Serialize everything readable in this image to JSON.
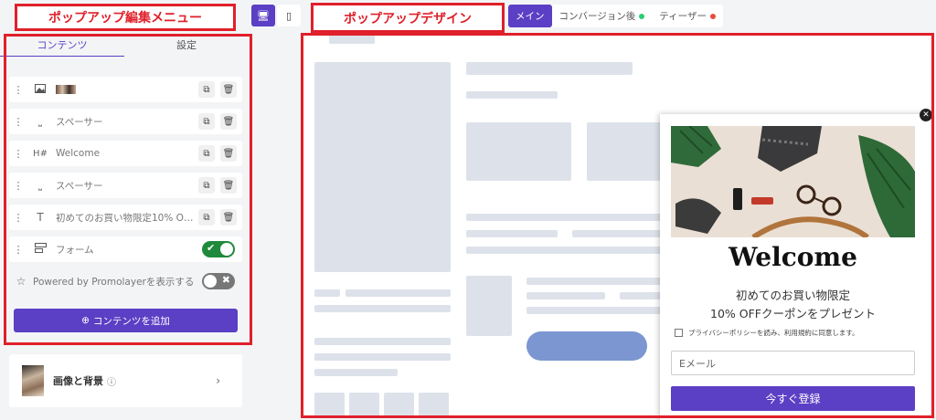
{
  "annotations": {
    "menu_label": "ポップアップ編集メニュー",
    "design_label": "ポップアップデザイン"
  },
  "editor": {
    "tabs": [
      "コンテンツ",
      "設定"
    ],
    "rows": [
      {
        "icon": "image-icon",
        "label": ""
      },
      {
        "icon": "spacer-icon",
        "label": "スペーサー"
      },
      {
        "icon": "heading-icon",
        "label": "Welcome"
      },
      {
        "icon": "spacer-icon",
        "label": "スペーサー"
      },
      {
        "icon": "text-icon",
        "label": "初めてのお買い物限定10% OFFクーポンをプレゼント"
      },
      {
        "icon": "form-icon",
        "label": "フォーム"
      }
    ],
    "powered_label": "Powered by Promolayerを表示する",
    "add_button": "コンテンツを追加",
    "bg_label": "画像と背景",
    "row_icon_glyphs": {
      "heading": "H#",
      "text": "T"
    },
    "form_toggle_on": true,
    "powered_toggle_on": false
  },
  "toolbar": {
    "views": [
      {
        "label": "メイン",
        "active": true
      },
      {
        "label": "コンバージョン後",
        "dot": "#2ecc71"
      },
      {
        "label": "ティーザー",
        "dot": "#e74c3c"
      }
    ]
  },
  "popup": {
    "title": "Welcome",
    "line1": "初めてのお買い物限定",
    "line2": "10% OFFクーポンをプレゼント",
    "privacy": "プライバシーポリシーを読み、利用規約に同意します。",
    "email_placeholder": "Eメール",
    "submit": "今すぐ登録"
  },
  "colors": {
    "accent": "#5b3fc4",
    "annotation": "#e0202a",
    "toggle_on": "#1f8a3b"
  }
}
